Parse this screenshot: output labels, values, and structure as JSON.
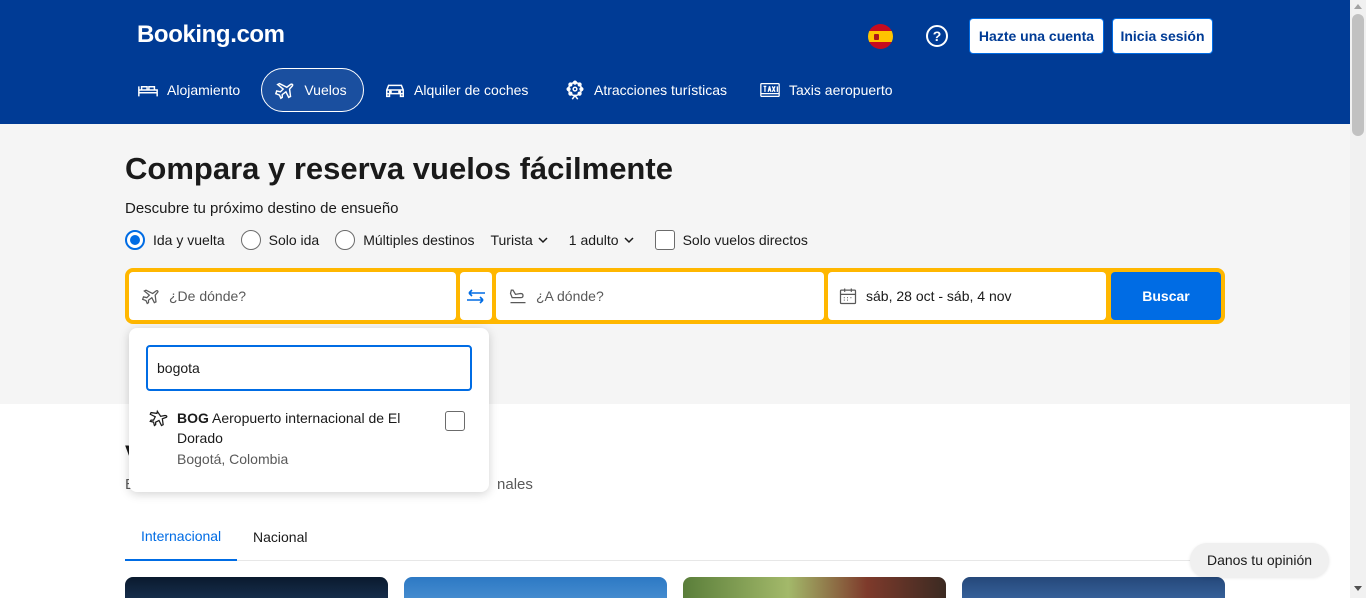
{
  "header": {
    "logo": "Booking.com",
    "help_symbol": "?",
    "signup_label": "Hazte una cuenta",
    "signin_label": "Inicia sesión"
  },
  "nav": {
    "items": [
      {
        "label": "Alojamiento",
        "icon": "bed-icon"
      },
      {
        "label": "Vuelos",
        "icon": "plane-icon",
        "active": true
      },
      {
        "label": "Alquiler de coches",
        "icon": "car-icon"
      },
      {
        "label": "Atracciones turísticas",
        "icon": "attractions-icon"
      },
      {
        "label": "Taxis aeropuerto",
        "icon": "taxi-icon"
      }
    ]
  },
  "hero": {
    "title": "Compara y reserva vuelos fácilmente",
    "subtitle": "Descubre tu próximo destino de ensueño",
    "trip_types": [
      "Ida y vuelta",
      "Solo ida",
      "Múltiples destinos"
    ],
    "cabin_class": "Turista",
    "passengers": "1 adulto",
    "direct_only_label": "Solo vuelos directos"
  },
  "search": {
    "from_placeholder": "¿De dónde?",
    "to_placeholder": "¿A dónde?",
    "dates": "sáb, 28 oct - sáb, 4 nov",
    "button_label": "Buscar"
  },
  "dropdown": {
    "query": "bogota",
    "result": {
      "code": "BOG",
      "name": "Aeropuerto internacional de El Dorado",
      "location": "Bogotá, Colombia"
    }
  },
  "section": {
    "title_partial": "V",
    "subtitle_start": "E",
    "subtitle_end": "nales",
    "tabs": [
      "Internacional",
      "Nacional"
    ]
  },
  "feedback_label": "Danos tu opinión",
  "colors": {
    "brand_blue": "#003b95",
    "accent_blue": "#006ce4",
    "search_border": "#ffb700"
  }
}
